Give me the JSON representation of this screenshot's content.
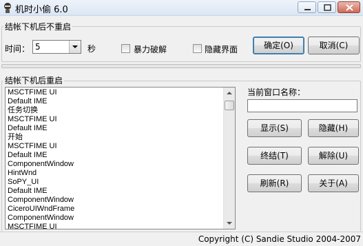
{
  "window": {
    "title": "机时小偷 6.0",
    "icon": "ninja-icon",
    "controls": [
      "minimize-icon",
      "maximize-icon",
      "close-icon"
    ]
  },
  "shutdown_group": {
    "legend": "结帐下机后不重启",
    "time_label": "时间：",
    "time_value": "5",
    "time_unit": "秒",
    "force_crack_label": "暴力破解",
    "force_crack_checked": false,
    "hide_ui_label": "隐藏界面",
    "hide_ui_checked": false,
    "ok_button": "确定(O)",
    "cancel_button": "取消(C)"
  },
  "restart_group": {
    "legend": "结帐下机后重启",
    "windows": [
      "MSCTFIME UI",
      "Default IME",
      "任务切换",
      "MSCTFIME UI",
      "Default IME",
      "开始",
      "MSCTFIME UI",
      "Default IME",
      "ComponentWindow",
      "HintWnd",
      "SoPY_UI",
      "Default IME",
      "ComponentWindow",
      "CiceroUIWndFrame",
      "ComponentWindow",
      "MSCTFIME UI"
    ],
    "current_window_label": "当前窗口名称：",
    "current_window_value": "",
    "show_button": "显示(S)",
    "hide_button": "隐藏(H)",
    "terminate_button": "终结(T)",
    "unlock_button": "解除(U)",
    "refresh_button": "刷新(R)",
    "about_button": "关于(A)"
  },
  "statusbar": {
    "copyright": "Copyright (C) Sandie Studio 2004-2007"
  }
}
